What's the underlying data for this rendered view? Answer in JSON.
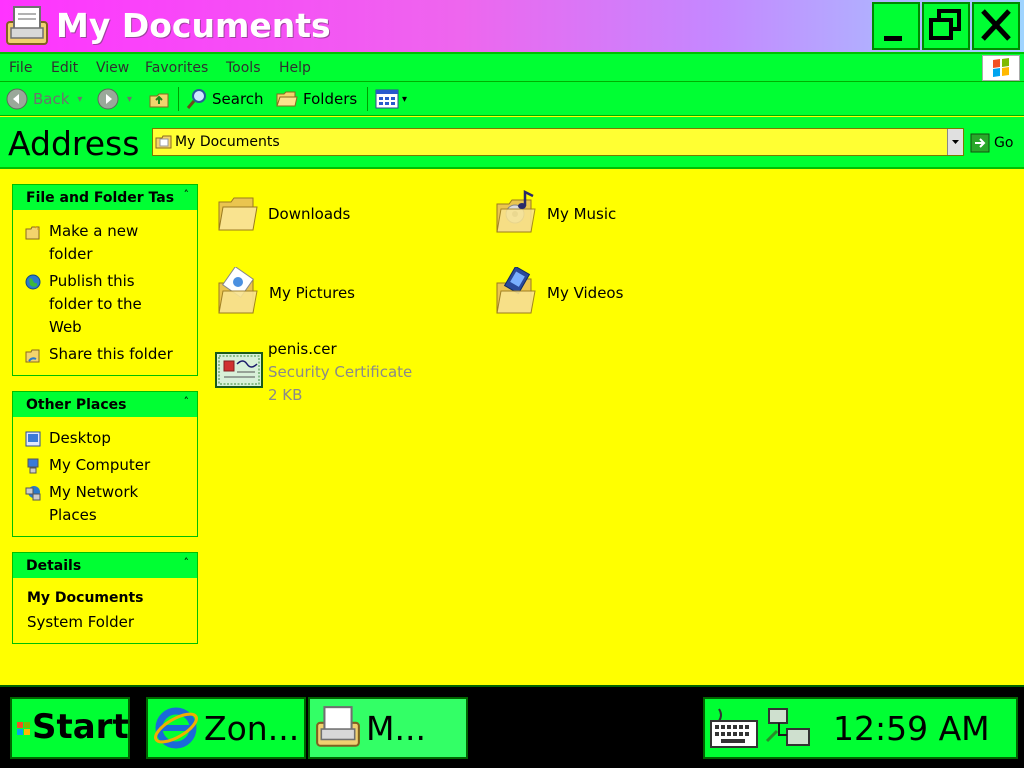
{
  "window": {
    "title": "My Documents"
  },
  "menu": {
    "file": "File",
    "edit": "Edit",
    "view": "View",
    "favorites": "Favorites",
    "tools": "Tools",
    "help": "Help"
  },
  "toolbar": {
    "back": "Back",
    "search": "Search",
    "folders": "Folders"
  },
  "address": {
    "label": "Address",
    "value": "My Documents",
    "go": "Go"
  },
  "panels": {
    "tasks": {
      "title": "File and Folder Tasks",
      "items": [
        "Make a new folder",
        "Publish this folder to the Web",
        "Share this folder"
      ]
    },
    "places": {
      "title": "Other Places",
      "items": [
        "Desktop",
        "My Computer",
        "My Network Places"
      ]
    },
    "details": {
      "title": "Details",
      "name": "My Documents",
      "type": "System Folder"
    }
  },
  "content": {
    "items": [
      {
        "name": "Downloads"
      },
      {
        "name": "My Music"
      },
      {
        "name": "My Pictures"
      },
      {
        "name": "My Videos"
      },
      {
        "name": "penis.cer",
        "type": "Security Certificate",
        "size": "2 KB"
      }
    ]
  },
  "taskbar": {
    "start": "Start",
    "tasks": [
      "Zon...",
      "M..."
    ],
    "clock": "12:59 AM"
  },
  "colors": {
    "background": "#ffff00",
    "bars": "#00ff33",
    "title_gradient_start": "#ff33ff",
    "title_gradient_end": "#9fd4ff"
  },
  "icons": [
    "printer-folder-icon",
    "minimize-icon",
    "maximize-icon",
    "close-icon",
    "windows-logo-icon",
    "back-arrow-icon",
    "forward-arrow-icon",
    "up-folder-icon",
    "search-icon",
    "folders-icon",
    "views-icon",
    "go-arrow-icon",
    "folder-icon",
    "music-folder-icon",
    "pictures-folder-icon",
    "videos-folder-icon",
    "certificate-icon",
    "globe-icon",
    "desktop-icon",
    "computer-icon",
    "network-icon",
    "internet-explorer-icon",
    "keyboard-icon",
    "network-tray-icon"
  ]
}
